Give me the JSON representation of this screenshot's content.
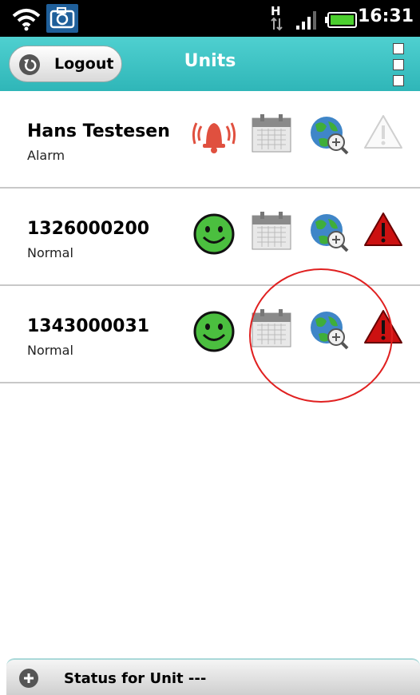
{
  "statusbar": {
    "time": "16:31",
    "network": "H"
  },
  "header": {
    "logout_label": "Logout",
    "title": "Units"
  },
  "units": [
    {
      "name": "Hans Testesen",
      "status": "Alarm",
      "status_icon": "alarm-bell-icon",
      "warning_active": false
    },
    {
      "name": "1326000200",
      "status": "Normal",
      "status_icon": "smiley-icon",
      "warning_active": true
    },
    {
      "name": "1343000031",
      "status": "Normal",
      "status_icon": "smiley-icon",
      "warning_active": true
    }
  ],
  "bottom": {
    "label": "Status for Unit ---"
  },
  "colors": {
    "accent": "#33b8b9",
    "alarm": "#e05040",
    "ok": "#3aa53a",
    "warning": "#cc1111",
    "annotation": "#e02020"
  }
}
